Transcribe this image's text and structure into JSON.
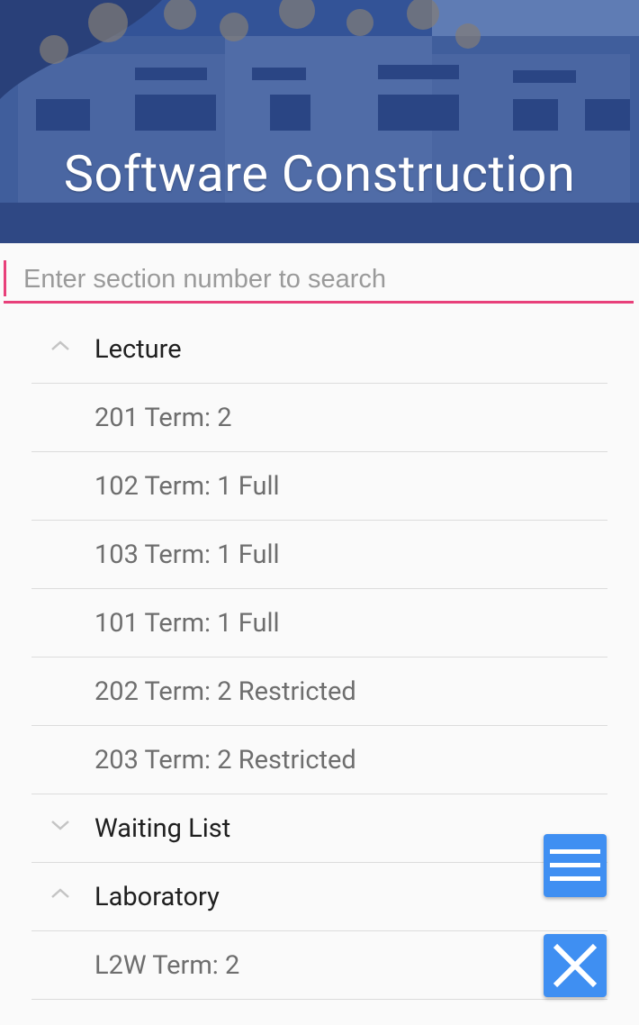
{
  "header": {
    "title": "Software Construction"
  },
  "search": {
    "placeholder": "Enter section number to search",
    "value": ""
  },
  "sections": [
    {
      "label": "Lecture",
      "expanded": true,
      "items": [
        {
          "label": "201 Term: 2"
        },
        {
          "label": "102 Term: 1 Full"
        },
        {
          "label": "103 Term: 1 Full"
        },
        {
          "label": "101 Term: 1 Full"
        },
        {
          "label": "202 Term: 2 Restricted"
        },
        {
          "label": "203 Term: 2 Restricted"
        }
      ]
    },
    {
      "label": "Waiting List",
      "expanded": false,
      "items": []
    },
    {
      "label": "Laboratory",
      "expanded": true,
      "items": [
        {
          "label": "L2W Term: 2"
        }
      ]
    }
  ],
  "fabs": {
    "menu_icon": "menu-icon",
    "close_icon": "close-icon"
  },
  "colors": {
    "accent": "#e8407a",
    "fab": "#3f8ff2",
    "header_overlay": "#2e4f95"
  }
}
